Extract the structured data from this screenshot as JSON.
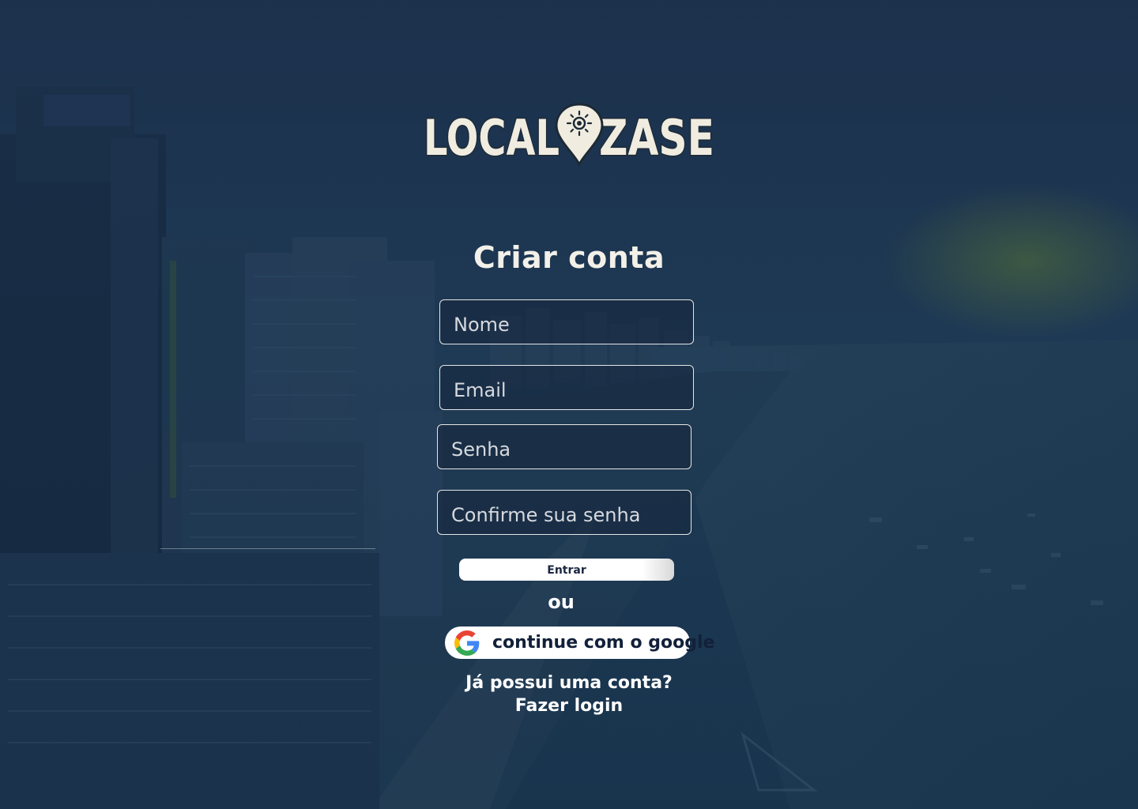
{
  "app": {
    "logo_text": "LOCALIZASE"
  },
  "form": {
    "title": "Criar conta",
    "name_placeholder": "Nome",
    "email_placeholder": "Email",
    "password_placeholder": "Senha",
    "confirm_password_placeholder": "Confirme sua senha",
    "submit_label": "Entrar",
    "separator": "ou",
    "google_label": "continue com o google",
    "have_account": "Já possui uma conta?",
    "login_link": "Fazer login"
  },
  "icons": {
    "google": "google-icon",
    "logo_pin": "map-pin-sun-icon"
  },
  "colors": {
    "overlay": "#1d3350",
    "text": "#ffffff",
    "logo_fill": "#f0ece0",
    "button_text": "#1b2740"
  }
}
